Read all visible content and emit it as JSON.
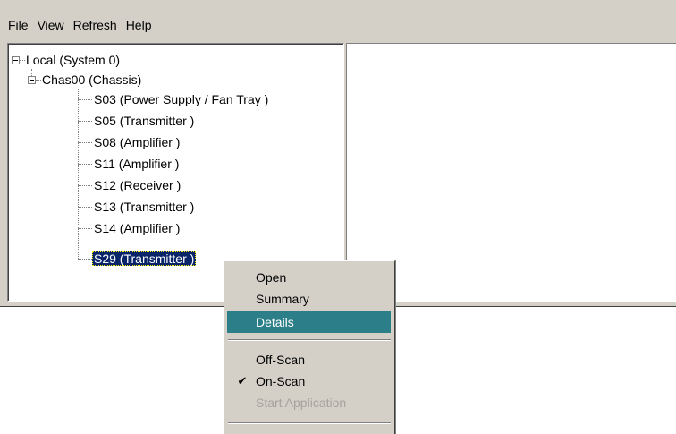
{
  "menubar": {
    "items": [
      {
        "label": "File"
      },
      {
        "label": "View"
      },
      {
        "label": "Refresh"
      },
      {
        "label": "Help"
      }
    ]
  },
  "tree": {
    "root": {
      "label": "Local (System 0)",
      "expanded": true
    },
    "chassis": {
      "label": "Chas00 (Chassis)",
      "expanded": true
    },
    "slots": [
      {
        "label": "S03 (Power Supply / Fan Tray )"
      },
      {
        "label": "S05 (Transmitter )"
      },
      {
        "label": "S08 (Amplifier )"
      },
      {
        "label": "S11 (Amplifier )"
      },
      {
        "label": "S12 (Receiver )"
      },
      {
        "label": "S13 (Transmitter )"
      },
      {
        "label": "S14 (Amplifier )"
      },
      {
        "label": "S29 (Transmitter )",
        "selected": true
      }
    ]
  },
  "context_menu": {
    "items": [
      {
        "label": "Open",
        "state": "normal"
      },
      {
        "label": "Summary",
        "state": "normal"
      },
      {
        "label": "Details",
        "state": "highlighted"
      },
      {
        "label": "Off-Scan",
        "state": "normal"
      },
      {
        "label": "On-Scan",
        "state": "checked"
      },
      {
        "label": "Start Application",
        "state": "disabled"
      }
    ],
    "check_glyph": "✔"
  },
  "colors": {
    "menu_bg": "#d4d0c8",
    "selection_bg": "#0a246a",
    "menu_highlight_bg": "#2c7f88",
    "disabled_text": "#a6a39c"
  }
}
